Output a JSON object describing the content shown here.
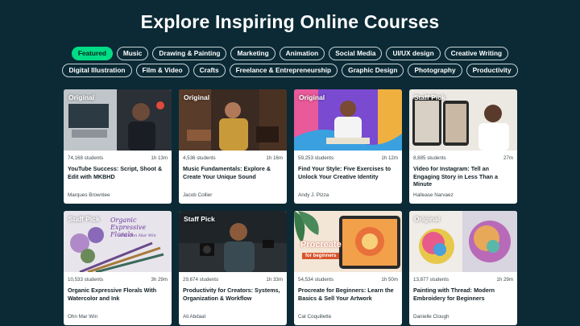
{
  "page": {
    "title": "Explore Inspiring Online Courses"
  },
  "categories_row1": [
    "Featured",
    "Music",
    "Drawing & Painting",
    "Marketing",
    "Animation",
    "Social Media",
    "UI/UX design",
    "Creative Writing"
  ],
  "categories_row2": [
    "Digital Illustration",
    "Film & Video",
    "Crafts",
    "Freelance & Entrepreneurship",
    "Graphic Design",
    "Photography",
    "Productivity"
  ],
  "active_category": "Featured",
  "courses": [
    {
      "tag": "Original",
      "students": "74,168 students",
      "duration": "1h 13m",
      "title": "YouTube Success: Script, Shoot & Edit with MKBHD",
      "teacher": "Marques Brownlee"
    },
    {
      "tag": "Original",
      "students": "4,536 students",
      "duration": "1h 16m",
      "title": "Music Fundamentals: Explore & Create Your Unique Sound",
      "teacher": "Jacob Collier"
    },
    {
      "tag": "Original",
      "students": "59,253 students",
      "duration": "1h 12m",
      "title": "Find Your Style: Five Exercises to Unlock Your Creative Identity",
      "teacher": "Andy J. Pizza"
    },
    {
      "tag": "Staff Pick",
      "students": "8,885 students",
      "duration": "27m",
      "title": "Video for Instagram: Tell an Engaging Story in Less Than a Minute",
      "teacher": "Hallease Narvaez"
    },
    {
      "tag": "Staff Pick",
      "students": "10,533 students",
      "duration": "3h 29m",
      "title": "Organic Expressive Florals With Watercolor and Ink",
      "teacher": "Ohn Mar Win",
      "thumb_text": "Organic Expressive Florals",
      "thumb_sub": "with Ohn Mar Win"
    },
    {
      "tag": "Staff Pick",
      "students": "29,674 students",
      "duration": "1h 33m",
      "title": "Productivity for Creators: Systems, Organization & Workflow",
      "teacher": "Ali Abdaal"
    },
    {
      "tag": "",
      "students": "54,534 students",
      "duration": "1h 50m",
      "title": "Procreate for Beginners: Learn the Basics & Sell Your Artwork",
      "teacher": "Cat Coquillette",
      "thumb_text": "Procreate",
      "thumb_sub": "for beginners"
    },
    {
      "tag": "Original",
      "students": "13,877 students",
      "duration": "1h 29m",
      "title": "Painting with Thread: Modern Embroidery for Beginners",
      "teacher": "Danielle Clough"
    }
  ],
  "colors": {
    "background": "#0b2a35",
    "accent": "#00dc86",
    "card": "#ffffff"
  }
}
